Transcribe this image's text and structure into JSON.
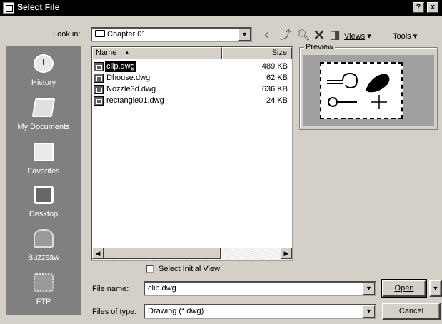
{
  "window": {
    "title": "Select File",
    "help_btn": "?",
    "close_btn": "x"
  },
  "lookin": {
    "label": "Look in:",
    "value": "Chapter 01"
  },
  "toolbar": {
    "views_label": "Views",
    "tools_label": "Tools"
  },
  "places": [
    {
      "label": "History",
      "icon": "history-icon"
    },
    {
      "label": "My Documents",
      "icon": "my-documents-icon"
    },
    {
      "label": "Favorites",
      "icon": "favorites-icon"
    },
    {
      "label": "Desktop",
      "icon": "desktop-icon"
    },
    {
      "label": "Buzzsaw",
      "icon": "buzzsaw-icon"
    },
    {
      "label": "FTP",
      "icon": "ftp-icon"
    }
  ],
  "filelist": {
    "col_name": "Name",
    "col_size": "Size",
    "files": [
      {
        "name": "clip.dwg",
        "size": "489 KB",
        "selected": true
      },
      {
        "name": "Dhouse.dwg",
        "size": "62 KB"
      },
      {
        "name": "Nozzle3d.dwg",
        "size": "636 KB"
      },
      {
        "name": "rectangle01.dwg",
        "size": "24 KB"
      }
    ]
  },
  "preview": {
    "label": "Preview"
  },
  "initial_view": {
    "label": "Select Initial View",
    "checked": false
  },
  "filename": {
    "label": "File name:",
    "value": "clip.dwg"
  },
  "filetype": {
    "label": "Files of type:",
    "value": "Drawing (*.dwg)"
  },
  "buttons": {
    "open": "Open",
    "cancel": "Cancel"
  }
}
